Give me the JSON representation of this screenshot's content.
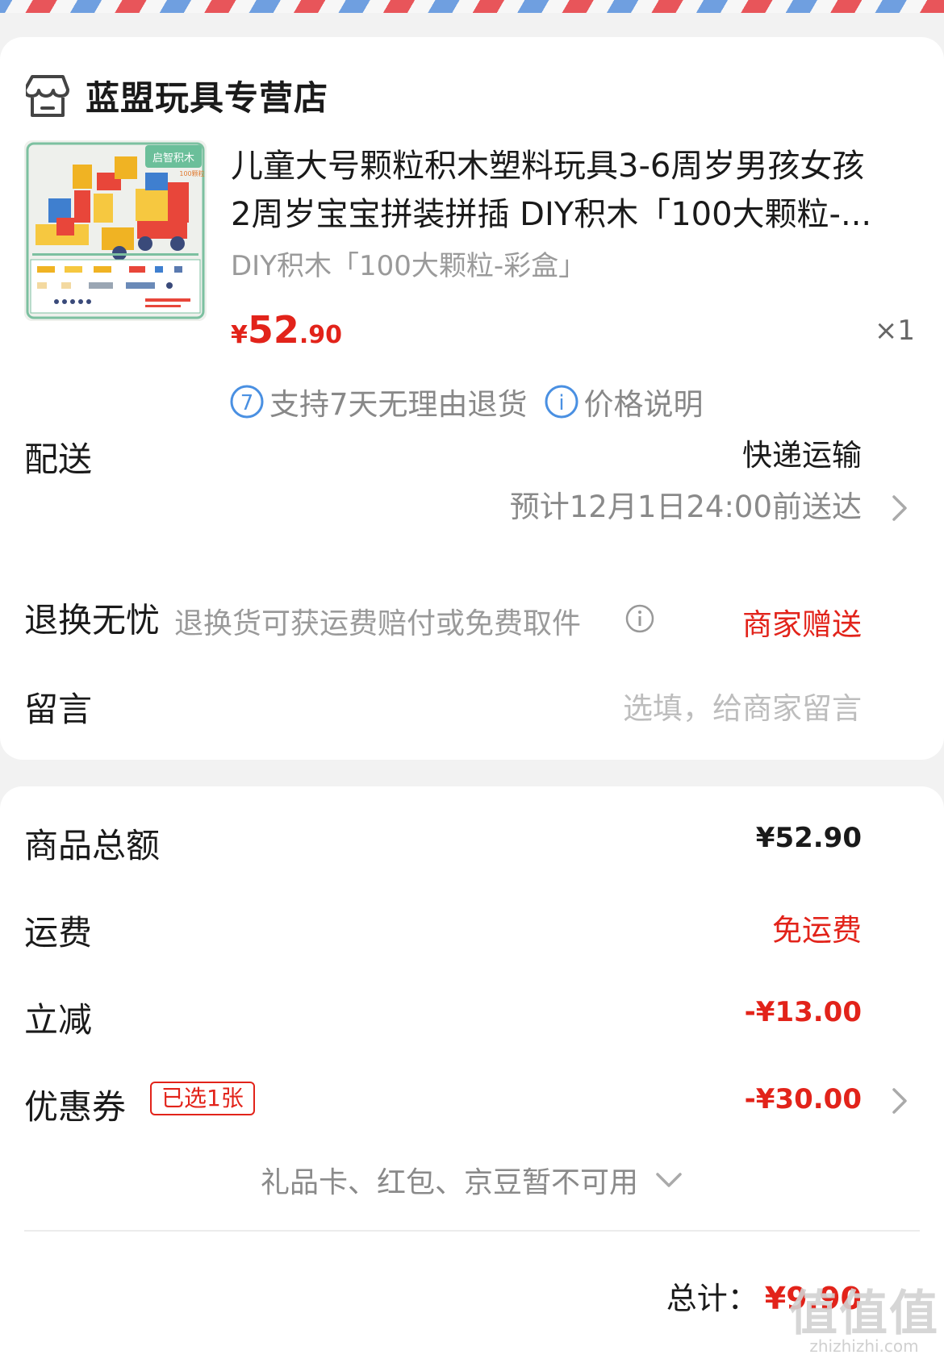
{
  "store": {
    "name": "蓝盟玩具专营店",
    "icon": "store-icon"
  },
  "product": {
    "title_line1": "儿童大号颗粒积木塑料玩具3-6周岁男孩女孩",
    "title_line2": "2周岁宝宝拼装拼插 DIY积木「100大颗粒-...",
    "sku": "DIY积木「100大颗粒-彩盒」",
    "price_symbol": "¥",
    "price_int": "52",
    "price_dec": ".90",
    "qty": "×1",
    "image_label": "启智积木",
    "image_sub": "100颗粒"
  },
  "badges": [
    {
      "icon": "seven-day-return-icon",
      "glyph": "7",
      "text": "支持7天无理由退货"
    },
    {
      "icon": "info-icon",
      "glyph": "i",
      "text": "价格说明"
    }
  ],
  "delivery": {
    "label": "配送",
    "method": "快递运输",
    "eta": "预计12月1日24:00前送达"
  },
  "returns": {
    "label": "退换无忧",
    "desc": "退换货可获运费赔付或免费取件",
    "value": "商家赠送"
  },
  "message": {
    "label": "留言",
    "placeholder": "选填，给商家留言"
  },
  "summary": {
    "goods_total_label": "商品总额",
    "goods_total": "¥52.90",
    "shipping_label": "运费",
    "shipping": "免运费",
    "discount_label": "立减",
    "discount": "-¥13.00",
    "coupon_label": "优惠券",
    "coupon_tag": "已选1张",
    "coupon": "-¥30.00",
    "unavailable": "礼品卡、红包、京豆暂不可用"
  },
  "total": {
    "label": "总计：",
    "value": "¥9.90"
  },
  "watermark": {
    "big": "值值值",
    "small": "zhizhizhi.com"
  },
  "colors": {
    "accent_red": "#e2231a",
    "info_blue": "#4a90e2",
    "muted": "#9a9a9a"
  }
}
